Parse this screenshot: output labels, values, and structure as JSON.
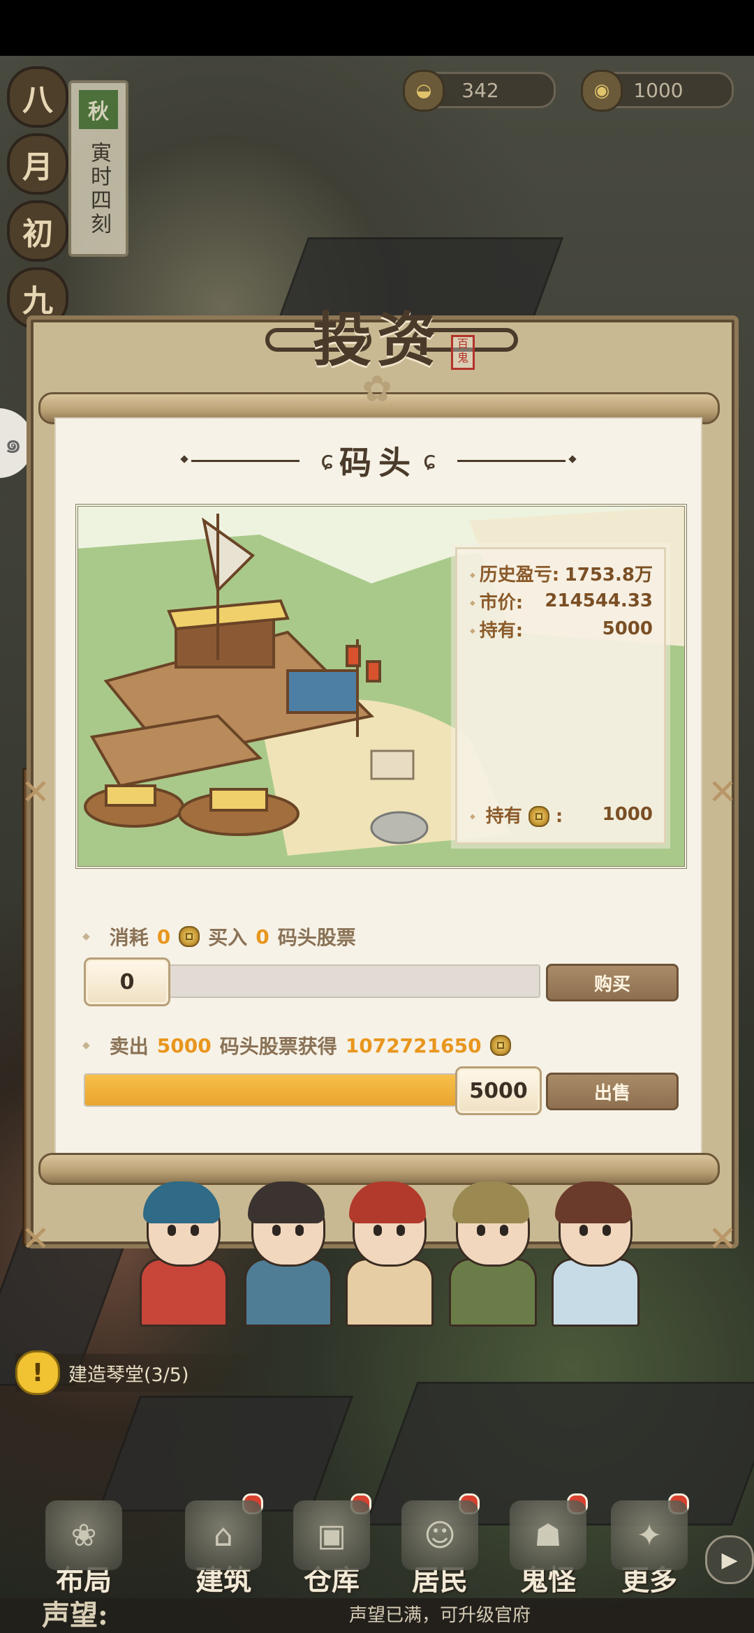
{
  "hud": {
    "date_chars": [
      "八",
      "月",
      "初",
      "九"
    ],
    "season": "秋",
    "time": "寅时四刻",
    "resource_1": {
      "icon": "bowl-icon",
      "value": "342"
    },
    "resource_2": {
      "icon": "coin-icon",
      "value": "1000"
    }
  },
  "modal": {
    "title": "投资",
    "seal_text": "百鬼",
    "section_title": "码头",
    "stats": {
      "history_pl_label": "历史盈亏:",
      "history_pl_value": "1753.8万",
      "market_price_label": "市价:",
      "market_price_value": "214544.33",
      "holding_label": "持有:",
      "holding_value": "5000",
      "coin_holding_label": "持有",
      "coin_holding_colon": ":",
      "coin_holding_value": "1000"
    },
    "buy": {
      "cost_label": "消耗",
      "cost_value": "0",
      "buy_label": "买入",
      "buy_value": "0",
      "stock_label": "码头股票",
      "slider_value": "0",
      "slider_fraction": 0.0,
      "button": "购买"
    },
    "sell": {
      "sell_label": "卖出",
      "sell_value": "5000",
      "gain_label": "码头股票获得",
      "gain_value": "1072721650",
      "slider_value": "5000",
      "slider_fraction": 1.0,
      "button": "出售"
    }
  },
  "quest": {
    "icon": "alert-icon",
    "text": "建造琴堂(3/5)"
  },
  "nav": [
    {
      "label": "布局",
      "icon": "rabbit-icon",
      "badge": false
    },
    {
      "label": "建筑",
      "icon": "pavilion-icon",
      "badge": true
    },
    {
      "label": "仓库",
      "icon": "barn-icon",
      "badge": true
    },
    {
      "label": "居民",
      "icon": "villager-icon",
      "badge": true
    },
    {
      "label": "鬼怪",
      "icon": "ghost-icon",
      "badge": true
    },
    {
      "label": "更多",
      "icon": "bag-icon",
      "badge": true
    }
  ],
  "prestige": {
    "label": "声望:",
    "note": "声望已满，可升级官府"
  },
  "colors": {
    "accent_orange": "#e8961e",
    "label_brown": "#8a5a2a",
    "button_brown": "#8e7050"
  }
}
